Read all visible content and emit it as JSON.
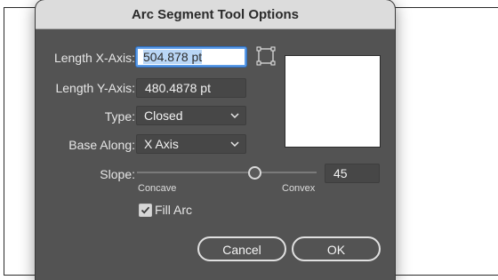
{
  "dialog": {
    "title": "Arc Segment Tool Options"
  },
  "length_x": {
    "label": "Length X-Axis:",
    "value": "504.878 pt"
  },
  "length_y": {
    "label": "Length Y-Axis:",
    "value": "480.4878 pt"
  },
  "type": {
    "label": "Type:",
    "value": "Closed"
  },
  "base_along": {
    "label": "Base Along:",
    "value": "X Axis"
  },
  "slope": {
    "label": "Slope:",
    "value": "45",
    "level": 45,
    "min_label": "Concave",
    "max_label": "Convex"
  },
  "fill_arc": {
    "label": "Fill Arc",
    "checked": true
  },
  "buttons": {
    "cancel": "Cancel",
    "ok": "OK"
  },
  "icons": {
    "reference_point": "reference-point-icon",
    "dropdown": "chevron-down-icon",
    "check": "checkmark-icon"
  },
  "colors": {
    "dialog_bg": "#535353",
    "focus_ring": "#5a9ae6"
  }
}
